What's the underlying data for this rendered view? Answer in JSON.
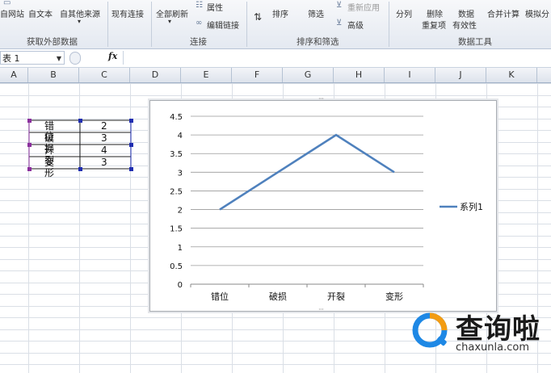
{
  "ribbon": {
    "buttons": [
      {
        "id": "from-web",
        "label": "自网站"
      },
      {
        "id": "from-text",
        "label": "自文本"
      },
      {
        "id": "from-other",
        "label": "自其他来源"
      },
      {
        "id": "existing-connections",
        "label": "现有连接"
      },
      {
        "id": "refresh-all",
        "label": "全部刷新"
      },
      {
        "id": "properties",
        "label": "属性"
      },
      {
        "id": "edit-links",
        "label": "编辑链接"
      },
      {
        "id": "sort",
        "label": "排序"
      },
      {
        "id": "filter",
        "label": "筛选"
      },
      {
        "id": "reapply",
        "label": "重新应用"
      },
      {
        "id": "advanced",
        "label": "高级"
      },
      {
        "id": "text-to-columns",
        "label": "分列"
      },
      {
        "id": "remove-duplicates-1",
        "label": "删除"
      },
      {
        "id": "remove-duplicates-2",
        "label": "重复项"
      },
      {
        "id": "validation-1",
        "label": "数据"
      },
      {
        "id": "validation-2",
        "label": "有效性"
      },
      {
        "id": "consolidate",
        "label": "合并计算"
      },
      {
        "id": "what-if",
        "label": "模拟分"
      }
    ],
    "groups": [
      "获取外部数据",
      "连接",
      "排序和筛选",
      "数据工具"
    ]
  },
  "formula_bar": {
    "name_box": "表 1",
    "fx": "fx",
    "value": ""
  },
  "columns": [
    "A",
    "B",
    "C",
    "D",
    "E",
    "F",
    "G",
    "H",
    "I",
    "J",
    "K"
  ],
  "table": [
    {
      "label": "错位",
      "value": "2"
    },
    {
      "label": "破损",
      "value": "3"
    },
    {
      "label": "开裂",
      "value": "4"
    },
    {
      "label": "变形",
      "value": "3"
    }
  ],
  "chart_data": {
    "type": "line",
    "categories": [
      "错位",
      "破损",
      "开裂",
      "变形"
    ],
    "series": [
      {
        "name": "系列1",
        "values": [
          2,
          3,
          4,
          3
        ],
        "color": "#4f81bd"
      }
    ],
    "ylim": [
      0,
      4.5
    ],
    "yticks": [
      "0",
      "0.5",
      "1",
      "1.5",
      "2",
      "2.5",
      "3",
      "3.5",
      "4",
      "4.5"
    ],
    "grid": true,
    "legend": "right"
  },
  "watermark": {
    "name": "查询啦",
    "url": "chaxunla.com",
    "colors": {
      "blue": "#1e88e5",
      "orange": "#f39c12"
    }
  }
}
